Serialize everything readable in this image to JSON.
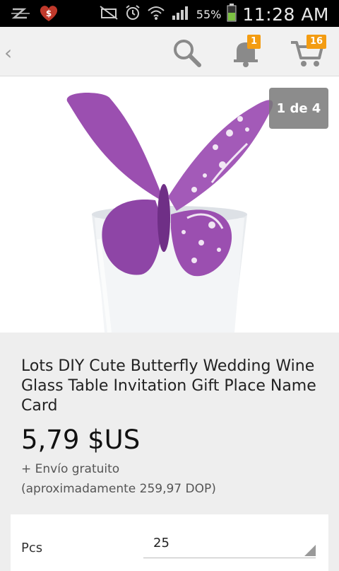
{
  "status_bar": {
    "battery_pct": "55%",
    "time": "11:28 AM"
  },
  "toolbar": {
    "notifications_count": "1",
    "cart_count": "16"
  },
  "gallery": {
    "pager": "1 de 4"
  },
  "product": {
    "title": "Lots DIY Cute Butterfly Wedding Wine Glass Table Invitation Gift Place Name Card",
    "price": "5,79 $US",
    "shipping": "+ Envío gratuito",
    "approx_price": "(aproximadamente 259,97 DOP)"
  },
  "options": {
    "label": "Pcs",
    "selected": "25"
  },
  "colors": {
    "badge": "#f39c12",
    "butterfly": "#9b4fb0"
  }
}
